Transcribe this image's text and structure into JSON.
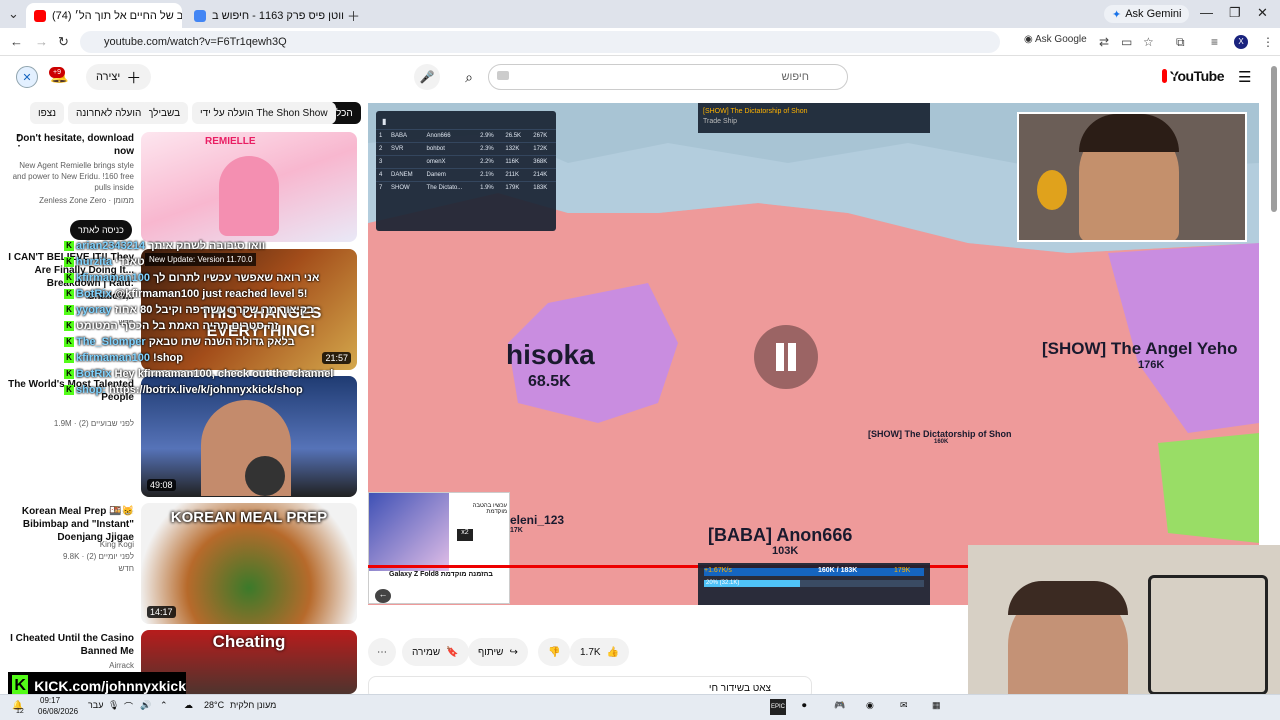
{
  "browser": {
    "tabs": [
      {
        "title": "(74) לייב של החיים אל תוך הל׳..."
      },
      {
        "title": "ווטן פיס פרק 1163 - חיפוש ב-..."
      }
    ],
    "ask_gemini": "Ask Gemini",
    "url": "youtube.com/watch?v=F6Tr1qewh3Q",
    "ask_google": "Ask Google",
    "profile_initial": "X"
  },
  "youtube": {
    "logo_text": "YouTube",
    "search_placeholder": "חיפוש",
    "create_label": "יצירה",
    "notifications_badge": "+9",
    "chips": [
      "הכל",
      "הועלה על ידי The Shon Show",
      "בשבילך",
      "הועלה לאחרונה",
      "נצפו"
    ]
  },
  "recommendations": [
    {
      "title": "Don't hesitate, download now",
      "meta": "New Agent Remielle brings style and power to New Eridu. !160 free pulls inside",
      "channel": "Zenless Zone Zero · ממומן",
      "cta": "כניסה לאתר",
      "thumb_text": "REMIELLE"
    },
    {
      "title": "I CAN'T BELIEVE IT!! They Are Finally Doing It... Breakdown | Raid: Shadow...",
      "meta": "Scratch Plays",
      "views": "חדש",
      "duration": "21:57",
      "thumb_text": "THIS CHANGES EVERYTHING!"
    },
    {
      "title": "The World's Most Talented People",
      "meta": "1.9M · לפני שבועיים (2)",
      "duration": "49:08"
    },
    {
      "title": "Korean Meal Prep 🍱😸 Bibimbap and \"Instant\" Doenjang Jjigae",
      "meta": "King Kogi",
      "views": "9.8K · לפני יומיים (2)",
      "badge": "חדש",
      "duration": "14:17",
      "thumb_text": "KOREAN MEAL PREP"
    },
    {
      "title": "I Cheated Until the Casino Banned Me",
      "meta": "Airrack",
      "thumb_text": "Cheating"
    }
  ],
  "video": {
    "leaderboard": {
      "rows": [
        {
          "rank": "1",
          "tag": "BABA",
          "name": "Anon666",
          "pct": "2.9%",
          "troops": "26.5K",
          "gold": "267K"
        },
        {
          "rank": "2",
          "tag": "SVR",
          "name": "bohbot",
          "pct": "2.3%",
          "troops": "132K",
          "gold": "172K"
        },
        {
          "rank": "3",
          "tag": "",
          "name": "omenX",
          "pct": "2.2%",
          "troops": "116K",
          "gold": "368K"
        },
        {
          "rank": "4",
          "tag": "DANEM",
          "name": "Danem",
          "pct": "2.1%",
          "troops": "211K",
          "gold": "214K"
        },
        {
          "rank": "7",
          "tag": "SHOW",
          "name": "The Dictato...",
          "pct": "1.9%",
          "troops": "179K",
          "gold": "183K"
        }
      ]
    },
    "event_banner": {
      "title": "[SHOW] The Dictatorship of Shon",
      "subtitle": "Trade Ship"
    },
    "map_labels": {
      "hisoka_name": "hisoka",
      "hisoka_troops": "68.5K",
      "angel_name": "[SHOW] The Angel Yeho",
      "angel_troops": "176K",
      "dictator_name": "[SHOW] The Dictatorship of Shon",
      "dictator_troops": "160K",
      "baba_name": "[BABA] Anon666",
      "baba_troops": "103K",
      "eleni_name": "eleni_123",
      "eleni_troops": "17K"
    },
    "hud": {
      "troops": "160K / 183K",
      "rate": "20% (32.1K)",
      "gold": "179K",
      "income": "+1.67K/s"
    },
    "ad": {
      "product": "Galaxy Z Fold8 בהזמנה מוקדמת",
      "offer": "עכשיו בהטבה מוקדמת",
      "x2": "x2"
    },
    "chat": [
      {
        "user": "arian2343214",
        "msg": "וואו סיבובה לשחק איתך"
      },
      {
        "user": "hurzita",
        "msg": "טאנדי"
      },
      {
        "user": "kfirmaman100",
        "msg": "אני רואה שאפשר עכשיו לתרום לך"
      },
      {
        "user": "BotRix",
        "msg": "@kfirmaman100 just reached level 5!"
      },
      {
        "user": "yyoray",
        "msg": "בקיצור מה שקרה עשה פה וקיבל 80 אחוז"
      },
      {
        "user": "",
        "msg": "זה סטרים תהיה האמת בל הכסף המטומט"
      },
      {
        "user": "The_Slomper",
        "msg": "בלאק גדולה השנה שתו טבאק"
      },
      {
        "user": "kfirmaman100",
        "msg": "!shop"
      },
      {
        "user": "BotRix",
        "msg": "Hey kfirmaman100, check out the channel"
      },
      {
        "user": "shop:",
        "msg": "https://botrix.live/k/johnnyxkick/shop"
      }
    ]
  },
  "actions": {
    "likes": "1.7K",
    "share": "שיתוף",
    "save": "שמירה",
    "stream_title": "צאט בשידור חי"
  },
  "kick_banner": "KICK.com/johnnyxkick",
  "taskbar": {
    "notif_count": "12",
    "time": "09:17",
    "date": "06/08/2026",
    "lang": "עבר",
    "weather_temp": "28°C",
    "weather_text": "מעונן חלקית"
  },
  "colors": {
    "youtube_red": "#ff0000",
    "kick_green": "#53fc18",
    "map_pink": "#ee9a9a",
    "map_purple": "#c98de0"
  }
}
